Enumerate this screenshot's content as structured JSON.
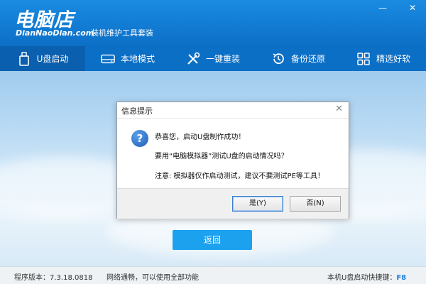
{
  "header": {
    "logo_text": "电脑店",
    "logo_subtext": "DianNaoDian.com",
    "tagline": "装机维护工具套装",
    "minimize_label": "—",
    "close_label": "✕"
  },
  "nav": {
    "items": [
      {
        "label": "U盘启动",
        "icon": "usb-drive-icon",
        "active": true
      },
      {
        "label": "本地模式",
        "icon": "hard-drive-icon",
        "active": false
      },
      {
        "label": "一键重装",
        "icon": "tools-icon",
        "active": false
      },
      {
        "label": "备份还原",
        "icon": "restore-icon",
        "active": false
      },
      {
        "label": "精选好软",
        "icon": "apps-grid-icon",
        "active": false
      }
    ]
  },
  "dialog": {
    "title": "信息提示",
    "close_label": "✕",
    "icon": "question-icon",
    "messages": [
      "恭喜您，启动U盘制作成功！",
      "要用“电脑模拟器”测试U盘的启动情况吗？",
      "注意: 模拟器仅作启动测试，建议不要测试PE等工具！"
    ],
    "yes_label": "是(Y)",
    "no_label": "否(N)"
  },
  "back_button_label": "返回",
  "status": {
    "version_label": "程序版本：",
    "version": "7.3.18.0818",
    "network_text": "网络通畅，可以使用全部功能",
    "hotkey_label": "本机U盘启动快捷键：",
    "hotkey": "F8"
  },
  "colors": {
    "header_blue": "#1a8be2",
    "nav_active": "#0a5fae",
    "button_blue": "#1ca1ef",
    "hotkey_blue": "#1a7fd8"
  }
}
